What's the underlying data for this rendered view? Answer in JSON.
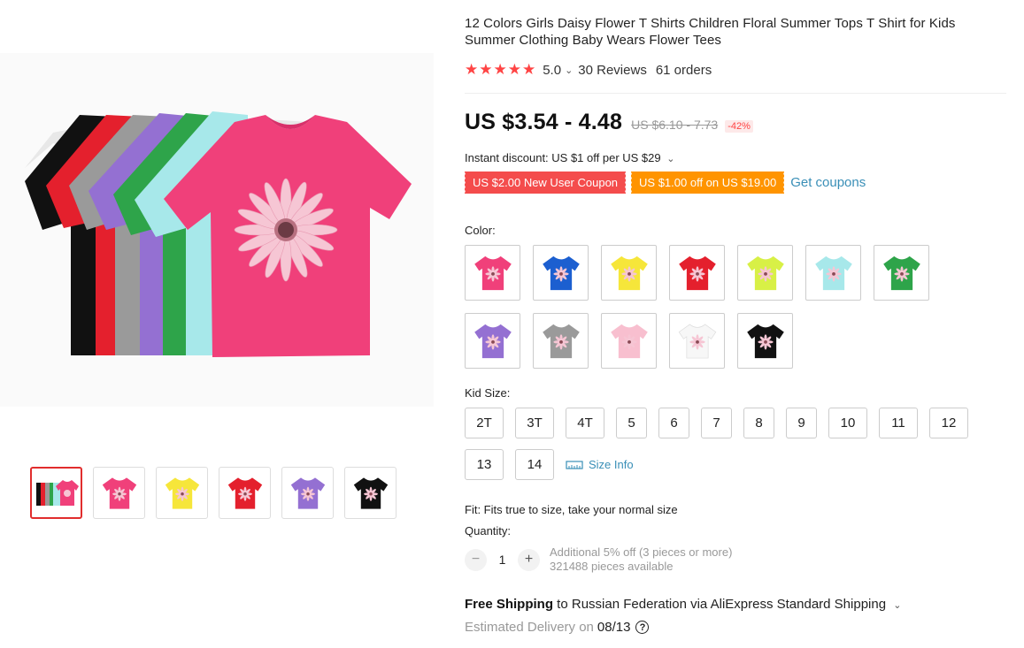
{
  "product": {
    "title": "12 Colors Girls Daisy Flower T Shirts Children Floral Summer Tops T Shirt for Kids Summer Clothing Baby Wears Flower Tees",
    "stars": "★★★★★",
    "rating": "5.0",
    "reviews": "30 Reviews",
    "orders": "61 orders"
  },
  "price": {
    "current": "US $3.54 - 4.48",
    "original": "US $6.10 - 7.73",
    "discount": "-42%"
  },
  "instant_discount": "Instant discount: US $1 off per US $29",
  "coupons": {
    "new_user": "US $2.00 New User Coupon",
    "spend": "US $1.00 off on US $19.00",
    "get_link": "Get coupons"
  },
  "color": {
    "label": "Color:",
    "options": [
      "#f0407a",
      "#1c5fd0",
      "#f6e63a",
      "#e4202d",
      "#d8f046",
      "#a7e8ea",
      "#2ea44a",
      "#9470d2",
      "#9a9a9a",
      "#f8bfcf",
      "#f7f7f7",
      "#111111"
    ]
  },
  "size": {
    "label": "Kid Size:",
    "options": [
      "2T",
      "3T",
      "4T",
      "5",
      "6",
      "7",
      "8",
      "9",
      "10",
      "11",
      "12",
      "13",
      "14"
    ],
    "info_link": "Size Info"
  },
  "fit": "Fit: Fits true to size, take your normal size",
  "quantity": {
    "label": "Quantity:",
    "value": "1",
    "minus": "−",
    "plus": "+",
    "additional": "Additional 5% off (3 pieces or more)",
    "available": "321488 pieces available"
  },
  "shipping": {
    "free": "Free Shipping",
    "rest": " to Russian Federation via AliExpress Standard Shipping",
    "estimated": "Estimated Delivery on",
    "date": "08/13",
    "help": "?"
  },
  "thumbnails": [
    "#f0407a",
    "#f0407a",
    "#f6e63a",
    "#e4202d",
    "#9470d2",
    "#111111"
  ],
  "colors_theme": {
    "accent_red": "#f44c4c",
    "coupon_orange": "#ff9400",
    "link_blue": "#3a8fb7"
  }
}
